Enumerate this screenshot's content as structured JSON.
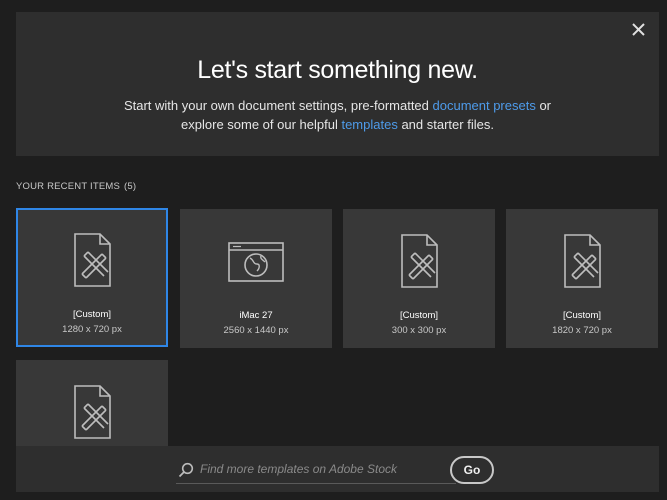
{
  "hero": {
    "title": "Let's start something new.",
    "line1_pre": "Start with your own document settings, pre-formatted ",
    "line1_link": "document presets",
    "line1_post": " or",
    "line2_pre": "explore some of our helpful ",
    "line2_link": "templates",
    "line2_post": " and starter files.",
    "close_icon": "close-icon"
  },
  "recent": {
    "heading": "YOUR RECENT ITEMS",
    "count": "(5)",
    "items": [
      {
        "name": "[Custom]",
        "dims": "1280 x 720 px",
        "icon": "document-pencil-icon",
        "selected": true
      },
      {
        "name": "iMac 27",
        "dims": "2560 x 1440 px",
        "icon": "web-globe-icon",
        "selected": false
      },
      {
        "name": "[Custom]",
        "dims": "300 x 300 px",
        "icon": "document-pencil-icon",
        "selected": false
      },
      {
        "name": "[Custom]",
        "dims": "1820 x 720 px",
        "icon": "document-pencil-icon",
        "selected": false
      },
      {
        "name": "",
        "dims": "",
        "icon": "document-pencil-icon",
        "selected": false
      }
    ]
  },
  "stock": {
    "placeholder": "Find more templates on Adobe Stock",
    "go_label": "Go"
  },
  "colors": {
    "background": "#1e1e1e",
    "panel": "#2e2e2e",
    "card": "#383838",
    "accent": "#2f86e6",
    "link": "#4e9bea"
  }
}
